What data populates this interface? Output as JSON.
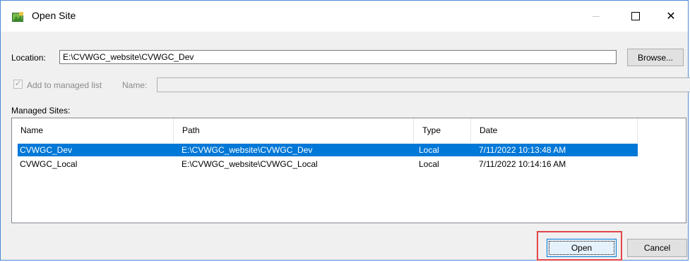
{
  "window": {
    "title": "Open Site",
    "icon": "site-folder-icon"
  },
  "location": {
    "label": "Location:",
    "value": "E:\\CVWGC_website\\CVWGC_Dev"
  },
  "browse_button": "Browse...",
  "managed_list": {
    "checkbox_label": "Add to managed list",
    "checked": true,
    "enabled": false,
    "name_label": "Name:",
    "name_value": ""
  },
  "managed_sites": {
    "label": "Managed Sites:",
    "columns": [
      "Name",
      "Path",
      "Type",
      "Date"
    ],
    "rows": [
      {
        "name": "CVWGC_Dev",
        "path": "E:\\CVWGC_website\\CVWGC_Dev",
        "type": "Local",
        "date": "7/11/2022 10:13:48 AM",
        "selected": true
      },
      {
        "name": "CVWGC_Local",
        "path": "E:\\CVWGC_website\\CVWGC_Local",
        "type": "Local",
        "date": "7/11/2022 10:14:16 AM",
        "selected": false
      }
    ]
  },
  "buttons": {
    "open": "Open",
    "cancel": "Cancel"
  },
  "colors": {
    "selection": "#0078d7",
    "highlight": "#e0474a"
  }
}
